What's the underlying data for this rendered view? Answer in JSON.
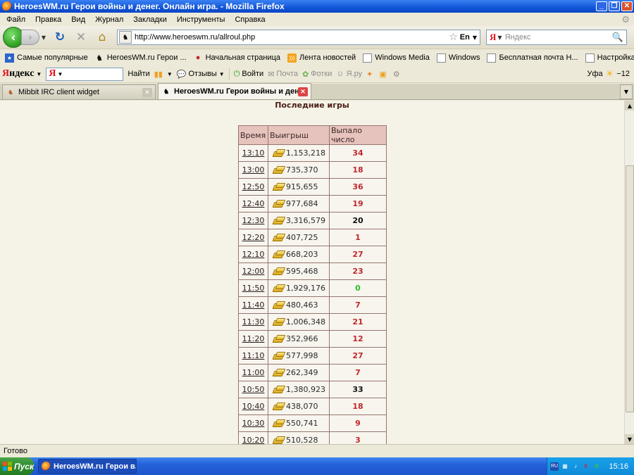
{
  "window": {
    "title": "HeroesWM.ru Герои войны и денег. Онлайн игра. - Mozilla Firefox",
    "buttons": {
      "minimize": "_",
      "maximize": "❐",
      "close": "✕"
    }
  },
  "menu": [
    "Файл",
    "Правка",
    "Вид",
    "Журнал",
    "Закладки",
    "Инструменты",
    "Справка"
  ],
  "nav": {
    "url": "http://www.heroeswm.ru/allroul.php",
    "lang": "En",
    "search_placeholder": "Яндекс",
    "search_engine_glyph": "Я"
  },
  "bookmarks": [
    {
      "label": "Самые популярные",
      "icon": "popular-icon"
    },
    {
      "label": "HeroesWM.ru Герои ...",
      "icon": "site-icon"
    },
    {
      "label": "Начальная страница",
      "icon": "start-page-icon"
    },
    {
      "label": "Лента новостей",
      "icon": "rss-icon"
    },
    {
      "label": "Windows Media",
      "icon": "page-icon"
    },
    {
      "label": "Windows",
      "icon": "page-icon"
    },
    {
      "label": "Бесплатная почта Н...",
      "icon": "page-icon"
    },
    {
      "label": "Настройка ссылок",
      "icon": "page-icon"
    }
  ],
  "yandex_bar": {
    "logo_first": "Я",
    "logo_rest": "ндекс",
    "input_glyph": "Я",
    "find": "Найти",
    "reviews": "Отзывы",
    "login": "Войти",
    "mail": "Почта",
    "photos": "Фотки",
    "yaru": "Я.ру",
    "city": "Уфа",
    "temp": "−12"
  },
  "tabs": [
    {
      "label": "Mibbit IRC client widget",
      "active": false
    },
    {
      "label": "HeroesWM.ru Герои войны и ден...",
      "active": true
    }
  ],
  "page": {
    "section_title": "Последние игры",
    "columns": [
      "Время",
      "Выигрыш",
      "Выпало число"
    ],
    "rows": [
      {
        "time": "13:10",
        "win": "1,153,218",
        "number": "34",
        "color": "red"
      },
      {
        "time": "13:00",
        "win": "735,370",
        "number": "18",
        "color": "red"
      },
      {
        "time": "12:50",
        "win": "915,655",
        "number": "36",
        "color": "red"
      },
      {
        "time": "12:40",
        "win": "977,684",
        "number": "19",
        "color": "red"
      },
      {
        "time": "12:30",
        "win": "3,316,579",
        "number": "20",
        "color": "black"
      },
      {
        "time": "12:20",
        "win": "407,725",
        "number": "1",
        "color": "red"
      },
      {
        "time": "12:10",
        "win": "668,203",
        "number": "27",
        "color": "red"
      },
      {
        "time": "12:00",
        "win": "595,468",
        "number": "23",
        "color": "red"
      },
      {
        "time": "11:50",
        "win": "1,929,176",
        "number": "0",
        "color": "green"
      },
      {
        "time": "11:40",
        "win": "480,463",
        "number": "7",
        "color": "red"
      },
      {
        "time": "11:30",
        "win": "1,006,348",
        "number": "21",
        "color": "red"
      },
      {
        "time": "11:20",
        "win": "352,966",
        "number": "12",
        "color": "red"
      },
      {
        "time": "11:10",
        "win": "577,998",
        "number": "27",
        "color": "red"
      },
      {
        "time": "11:00",
        "win": "262,349",
        "number": "7",
        "color": "red"
      },
      {
        "time": "10:50",
        "win": "1,380,923",
        "number": "33",
        "color": "black"
      },
      {
        "time": "10:40",
        "win": "438,070",
        "number": "18",
        "color": "red"
      },
      {
        "time": "10:30",
        "win": "550,741",
        "number": "9",
        "color": "red"
      },
      {
        "time": "10:20",
        "win": "510,528",
        "number": "3",
        "color": "red"
      }
    ]
  },
  "status": "Готово",
  "taskbar": {
    "start": "Пуск",
    "task": "HeroesWM.ru Герои в...",
    "lang": "RU",
    "clock": "15:16"
  },
  "colors": {
    "red": "#c0282c",
    "black": "#111111",
    "green": "#2ec02e",
    "header_bg": "#e7c3bd"
  }
}
